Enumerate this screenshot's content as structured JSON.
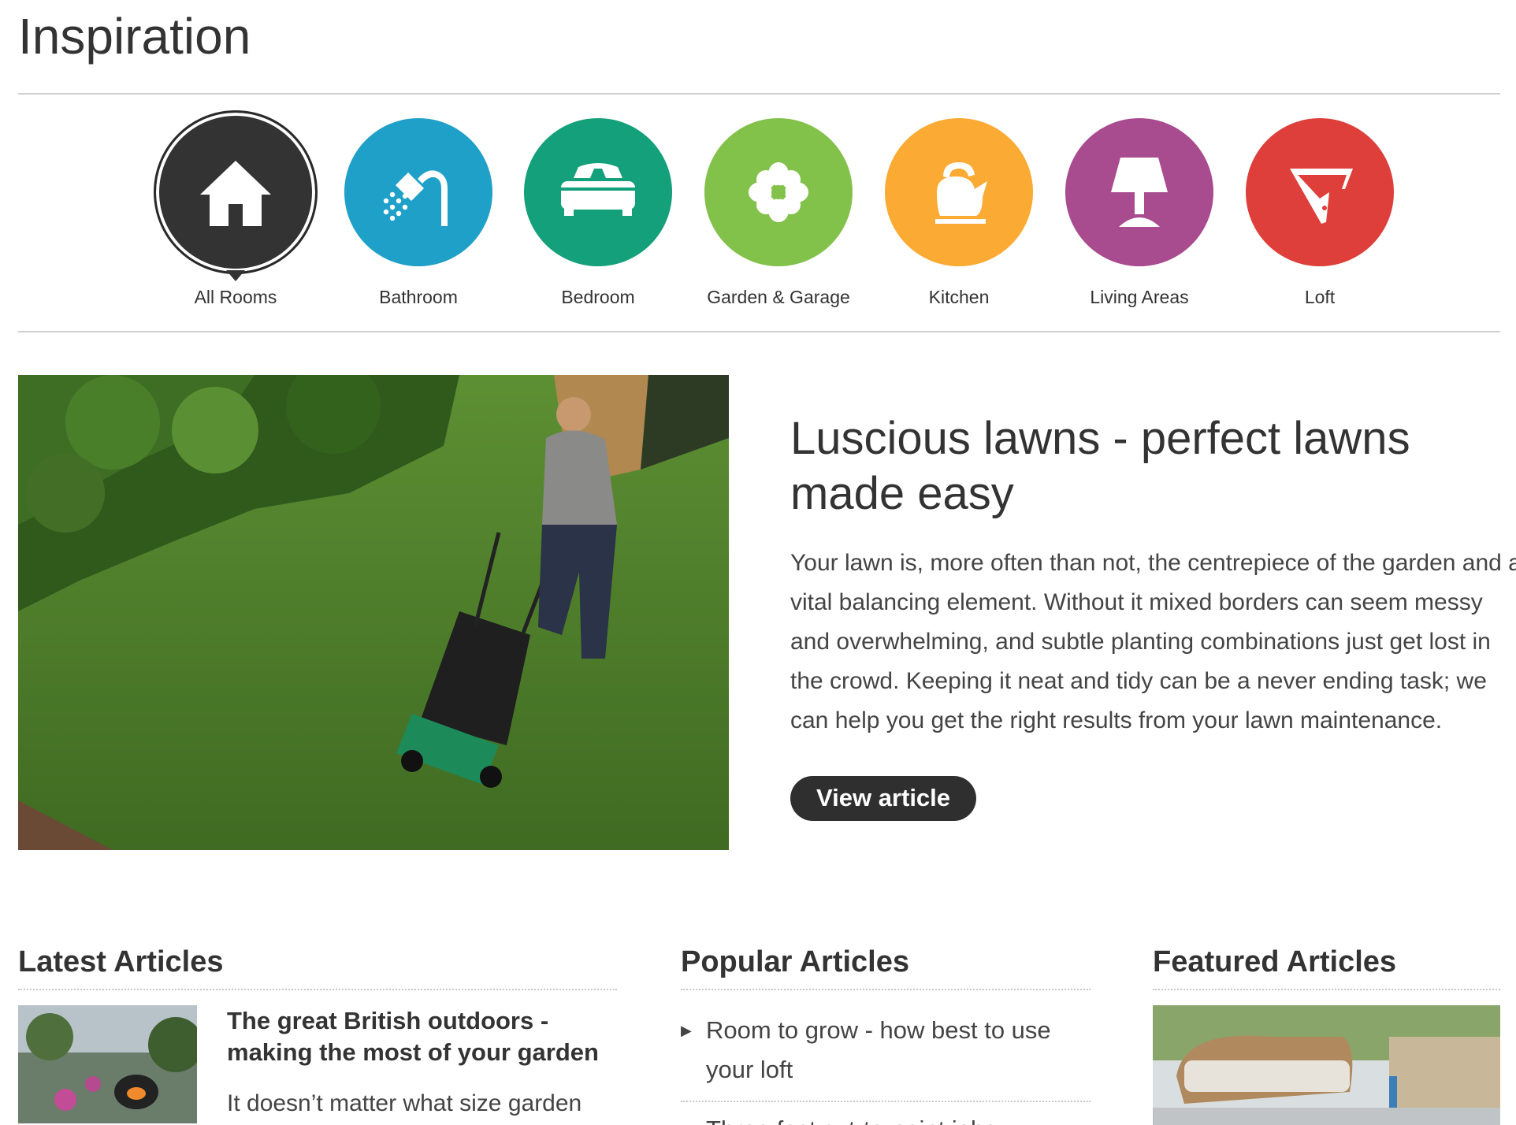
{
  "page": {
    "title": "Inspiration"
  },
  "rooms": [
    {
      "label": "All Rooms",
      "icon": "house-icon",
      "color": "#333333",
      "active": true
    },
    {
      "label": "Bathroom",
      "icon": "shower-icon",
      "color": "#1fa0c8",
      "active": false
    },
    {
      "label": "Bedroom",
      "icon": "bed-icon",
      "color": "#14a07a",
      "active": false
    },
    {
      "label": "Garden & Garage",
      "icon": "flower-icon",
      "color": "#82c24a",
      "active": false
    },
    {
      "label": "Kitchen",
      "icon": "kettle-icon",
      "color": "#fbaa33",
      "active": false
    },
    {
      "label": "Living Areas",
      "icon": "lamp-icon",
      "color": "#a84b8f",
      "active": false
    },
    {
      "label": "Loft",
      "icon": "loft-icon",
      "color": "#de3f3a",
      "active": false
    }
  ],
  "hero": {
    "title": "Luscious lawns - perfect lawns made easy",
    "body": "Your lawn is, more often than not, the centrepiece of the garden and a vital balancing element. Without it mixed borders can seem messy and overwhelming, and subtle planting combinations just get lost in the crowd. Keeping it neat and tidy can be a never ending task; we can help you get the right results from your lawn maintenance.",
    "button": "View article"
  },
  "latest": {
    "title": "Latest Articles",
    "items": [
      {
        "headline": "The great British outdoors - making the most of your garden",
        "snippet": "It doesn’t matter what size garden"
      }
    ]
  },
  "popular": {
    "title": "Popular Articles",
    "items": [
      {
        "label": "Room to grow - how best to use your loft"
      },
      {
        "label": "Three fast cut-to-paint jobs"
      }
    ]
  },
  "featured": {
    "title": "Featured Articles"
  }
}
